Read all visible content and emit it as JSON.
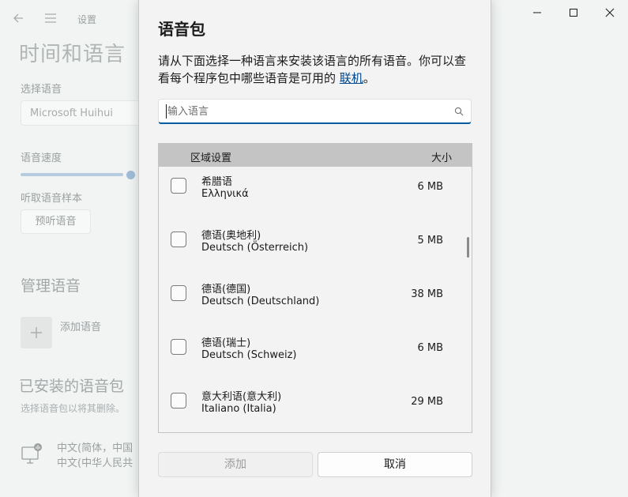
{
  "background": {
    "app_title": "设置",
    "page_title": "时间和语言",
    "voice_label": "选择语音",
    "voice_value": "Microsoft Huihui",
    "speed_label": "语音速度",
    "speed_fraction": 0.9,
    "sample_label": "听取语音样本",
    "preview_button": "预听语音",
    "manage_title": "管理语音",
    "add_voice_label": "添加语音",
    "installed_title": "已安装的语音包",
    "installed_hint": "选择语音包以将其删除。",
    "installed_item_line1": "中文(简体，中国",
    "installed_item_line2": "中文(中华人民共"
  },
  "dialog": {
    "title": "语音包",
    "description_prefix": "请从下面选择一种语言来安装该语言的所有语音。你可以查看每个程序包中哪些语音是可用的",
    "link_text": "联机",
    "description_suffix": "。",
    "search_placeholder": "输入语言",
    "header_region": "区域设置",
    "header_size": "大小",
    "rows": [
      {
        "name": "希腊语",
        "native": "Ελληνικά",
        "size": "6 MB"
      },
      {
        "name": "德语(奥地利)",
        "native": "Deutsch (Österreich)",
        "size": "5 MB"
      },
      {
        "name": "德语(德国)",
        "native": "Deutsch (Deutschland)",
        "size": "38 MB"
      },
      {
        "name": "德语(瑞士)",
        "native": "Deutsch (Schweiz)",
        "size": "6 MB"
      },
      {
        "name": "意大利语(意大利)",
        "native": "Italiano (Italia)",
        "size": "29 MB"
      }
    ],
    "add_button": "添加",
    "cancel_button": "取消"
  },
  "colors": {
    "accent": "#005a9e",
    "link": "#00468c",
    "header_bg": "#c4c4c4"
  }
}
